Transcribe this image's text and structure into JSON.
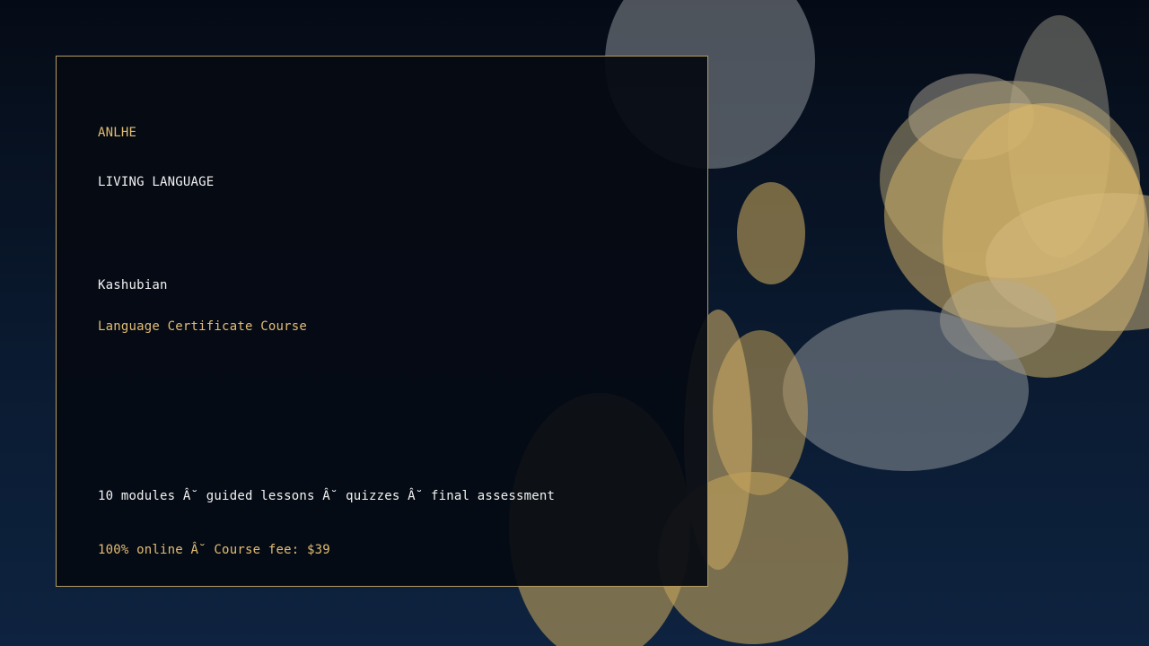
{
  "brand": "ANLHE",
  "kicker": "LIVING LANGUAGE",
  "language": "Kashubian",
  "course_title": "Language Certificate Course",
  "details": "10 modules Â˘ guided lessons Â˘ quizzes Â˘ final assessment",
  "pricing": "100% online Â˘ Course fee: $39",
  "colors": {
    "accent_gold": "#e3bd72",
    "text_white": "#f2f2f2",
    "card_border": "#b59a60",
    "background_top": "#050b16",
    "background_bottom": "#0e2340"
  }
}
